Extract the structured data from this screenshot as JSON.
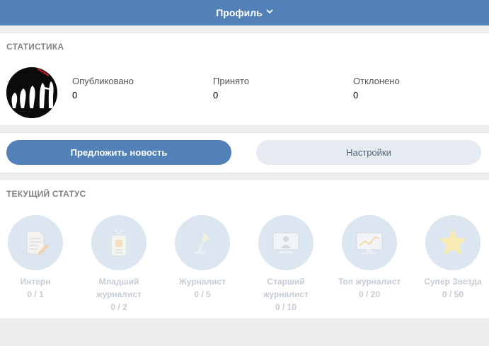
{
  "header": {
    "title": "Профиль",
    "chevron": "chevron-down-icon"
  },
  "stats": {
    "title": "СТАТИСТИКА",
    "items": [
      {
        "label": "Опубликовано",
        "value": "0"
      },
      {
        "label": "Принято",
        "value": "0"
      },
      {
        "label": "Отклонено",
        "value": "0"
      }
    ]
  },
  "actions": {
    "suggest": "Предложить новость",
    "settings": "Настройки"
  },
  "status": {
    "title": "ТЕКУЩИЙ СТАТУС",
    "levels": [
      {
        "name": "Интерн",
        "progress": "0 / 1",
        "icon": "document-pen-icon"
      },
      {
        "name": "Младший журналист",
        "progress": "0 / 2",
        "icon": "badge-icon"
      },
      {
        "name": "Журналист",
        "progress": "0 / 5",
        "icon": "microphone-icon"
      },
      {
        "name": "Старший журналист",
        "progress": "0 / 10",
        "icon": "presenter-screen-icon"
      },
      {
        "name": "Топ журналист",
        "progress": "0 / 20",
        "icon": "monitor-chart-icon"
      },
      {
        "name": "Супер Звезда",
        "progress": "0 / 50",
        "icon": "star-icon"
      }
    ]
  },
  "colors": {
    "brand": "#5181b8",
    "secondary_btn": "#e5ebf1",
    "level_circle": "#d7e2ee",
    "background": "#edeef0"
  }
}
